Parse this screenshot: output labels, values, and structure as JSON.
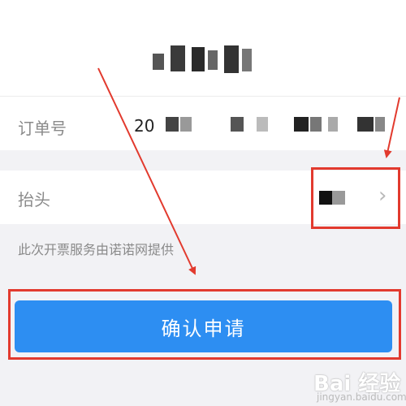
{
  "order": {
    "label": "订单号",
    "value_prefix": "20"
  },
  "invoice_title": {
    "label": "抬头"
  },
  "note": "此次开票服务由诺诺网提供",
  "confirm_button": "确认申请",
  "watermark": {
    "text": "Bai 经验",
    "subtext": "jingyan.baidu.com"
  },
  "colors": {
    "accent": "#2d8ef2",
    "annotation": "#e23a2e"
  },
  "icons": {
    "chevron": "chevron-right-icon"
  }
}
